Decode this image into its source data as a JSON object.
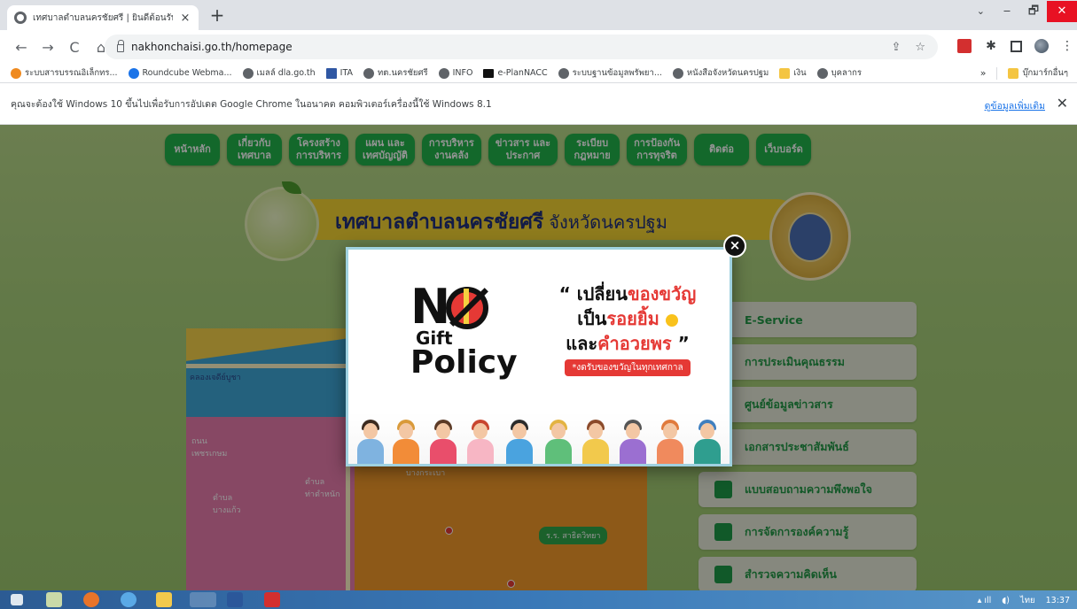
{
  "browser": {
    "tab_title": "เทศบาลตำบลนครชัยศรี | ยินดีต้อนรับ",
    "tab_close": "×",
    "new_tab": "+",
    "url": "nakhonchaisi.go.th/homepage",
    "nav": {
      "back": "←",
      "forward": "→",
      "reload": "C",
      "home": "⌂"
    },
    "window_controls": {
      "tab_search": "⌄",
      "minimize": "‒",
      "restore": "🗗",
      "close": "✕"
    },
    "omnibox_icons": {
      "share": "⇪",
      "bookmark_star": "☆"
    },
    "extensions": [
      "pdf-icon",
      "puzzle-icon",
      "sidepanel-icon",
      "profile-avatar",
      "menu-icon"
    ]
  },
  "bookmarks": {
    "items": [
      {
        "label": "ระบบสารบรรณอิเล็กทร...",
        "icon": "orange-globe-icon"
      },
      {
        "label": "Roundcube Webma...",
        "icon": "roundcube-icon"
      },
      {
        "label": "เมลล์ dla.go.th",
        "icon": "globe-icon"
      },
      {
        "label": "ITA",
        "icon": "ita-icon"
      },
      {
        "label": "ทต.นครชัยศรี",
        "icon": "globe-icon"
      },
      {
        "label": "INFO",
        "icon": "globe-icon"
      },
      {
        "label": "e-PlanNACC",
        "icon": "house-icon"
      },
      {
        "label": "ระบบฐานข้อมูลพรัพยา...",
        "icon": "globe-icon"
      },
      {
        "label": "หนังสือจังหวัดนครปฐม",
        "icon": "globe-icon"
      },
      {
        "label": "เงิน",
        "icon": "folder-icon"
      },
      {
        "label": "บุคลากร",
        "icon": "globe-icon"
      }
    ],
    "more": "»",
    "other_folder": "บุ๊กมาร์กอื่นๆ"
  },
  "infobar": {
    "message": "คุณจะต้องใช้ Windows 10 ขึ้นไปเพื่อรับการอัปเดต Google Chrome ในอนาคต คอมพิวเตอร์เครื่องนี้ใช้ Windows 8.1",
    "link": "ดูข้อมูลเพิ่มเติม",
    "close": "✕"
  },
  "site": {
    "menu": [
      "หน้าหลัก",
      "เกี่ยวกับ\nเทศบาล",
      "โครงสร้าง\nการบริหาร",
      "แผน และ\nเทศบัญญัติ",
      "การบริหาร\nงานคลัง",
      "ข่าวสาร และ\nประกาศ",
      "ระเบียบ\nกฎหมาย",
      "การป้องกัน\nการทุจริต",
      "ติดต่อ",
      "เว็บบอร์ด"
    ],
    "banner_title": "เทศบาลตำบลนครชัยศรี",
    "banner_subtitle": "จังหวัดนครปฐม",
    "side_menu": [
      "E-Service",
      "การประเมินคุณธรรม",
      "ศูนย์ข้อมูลข่าวสาร",
      "เอกสารประชาสัมพันธ์",
      "แบบสอบถามความพึงพอใจ",
      "การจัดการองค์ความรู้",
      "สำรวจความคิดเห็น"
    ],
    "map_labels": {
      "canal": "คลองเจดีย์บูชา",
      "road": "ถนน\nเพชรเกษม",
      "tambon1": "ตำบล\nบางแก้ว",
      "tambon2": "ตำบล\nท่าตำหนัก",
      "area": "บางกระเบา",
      "school": "ร.ร. สาธิตวิทยา"
    }
  },
  "modal": {
    "close": "×",
    "logo_n": "N",
    "logo_gift": "Gift",
    "logo_policy": "Policy",
    "slogan_open": "“ เปลี่ยน",
    "slogan_red1": "ของขวัญ",
    "slogan_line2a": "เป็น",
    "slogan_red2": "รอยยิ้ม",
    "slogan_line3a": "และ",
    "slogan_red3": "คำอวยพร",
    "slogan_close": " ”",
    "tag": "*งดรับของขวัญในทุกเทศกาล"
  },
  "taskbar": {
    "apps": [
      "start-icon",
      "recycle-icon",
      "firefox-icon",
      "ie-icon",
      "explorer-icon",
      "chrome-icon",
      "word-icon",
      "acrobat-icon"
    ],
    "tray_lang": "ไทย",
    "clock": "13:37"
  },
  "colors": {
    "nav_green": "#21b34a",
    "banner_yellow": "#f5d433",
    "banner_text": "#1f2f7a",
    "accent_red": "#e53935"
  }
}
